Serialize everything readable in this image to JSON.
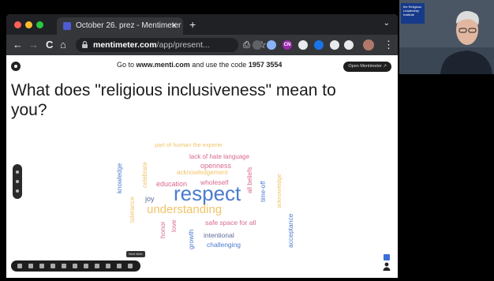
{
  "browser": {
    "tab_title": "October 26. prez - Mentimeter",
    "tab_close": "×",
    "new_tab": "+",
    "tab_menu": "⌄",
    "url_host": "mentimeter.com",
    "url_path": "/app/present...",
    "accent": "#4e5cd4"
  },
  "nav": {
    "back": "←",
    "forward": "→",
    "reload": "C",
    "home": "⌂",
    "share": "⎙",
    "star": "☆"
  },
  "extensions": [
    {
      "name": "extension-1",
      "label": "",
      "color": "#5f6368"
    },
    {
      "name": "extension-2",
      "label": "",
      "color": "#8ab4f8"
    },
    {
      "name": "extension-cn",
      "label": "CN",
      "color": "#9c27b0"
    },
    {
      "name": "extension-4",
      "label": "",
      "color": "#e8eaed"
    },
    {
      "name": "extension-5",
      "label": "",
      "color": "#1a73e8"
    },
    {
      "name": "puzzle",
      "label": "",
      "color": "#e8eaed"
    },
    {
      "name": "sidepanel",
      "label": "",
      "color": "#e8eaed"
    },
    {
      "name": "avatar",
      "label": "",
      "color": "#b07868"
    }
  ],
  "page": {
    "join_prefix": "Go to",
    "join_site": "www.menti.com",
    "join_middle": "and use the code",
    "join_code": "1957 3554",
    "open_button": "Open Mentimeter",
    "question": "What does \"religious inclusiveness\" mean to you?",
    "next_slide_tooltip": "Next slide"
  },
  "word_cloud": [
    {
      "text": "part of human the experie",
      "color": "#f2c46a",
      "size": 7.5
    },
    {
      "text": "lack of hate language",
      "color": "#d9698a",
      "size": 8
    },
    {
      "text": "openness",
      "color": "#d9698a",
      "size": 9
    },
    {
      "text": "acknowledgement",
      "color": "#f2c46a",
      "size": 8
    },
    {
      "text": "wholeself",
      "color": "#d9698a",
      "size": 8.5
    },
    {
      "text": "education",
      "color": "#d9698a",
      "size": 9
    },
    {
      "text": "respect",
      "color": "#4a7bd0",
      "size": 26
    },
    {
      "text": "joy",
      "color": "#5b6b9a",
      "size": 9
    },
    {
      "text": "understanding",
      "color": "#f2c46a",
      "size": 15
    },
    {
      "text": "safe space for all",
      "color": "#d9698a",
      "size": 8.5
    },
    {
      "text": "intentional",
      "color": "#5b6b9a",
      "size": 8.5
    },
    {
      "text": "challenging",
      "color": "#4a7bd0",
      "size": 8.5
    },
    {
      "text": "knowledge",
      "color": "#4a7bd0",
      "size": 8
    },
    {
      "text": "celebrate",
      "color": "#f2c46a",
      "size": 8
    },
    {
      "text": "tolerance",
      "color": "#f2c46a",
      "size": 8
    },
    {
      "text": "honor",
      "color": "#d9698a",
      "size": 8.5
    },
    {
      "text": "love",
      "color": "#d9698a",
      "size": 8.5
    },
    {
      "text": "growth",
      "color": "#4a7bd0",
      "size": 8.5
    },
    {
      "text": "all beliefs",
      "color": "#d9698a",
      "size": 8
    },
    {
      "text": "time-off",
      "color": "#4a7bd0",
      "size": 8
    },
    {
      "text": "acknowledge",
      "color": "#f2c46a",
      "size": 7.5
    },
    {
      "text": "acceptance",
      "color": "#4a7bd0",
      "size": 8.5
    }
  ],
  "video_logo_text": "the Religious Leadership Institute"
}
